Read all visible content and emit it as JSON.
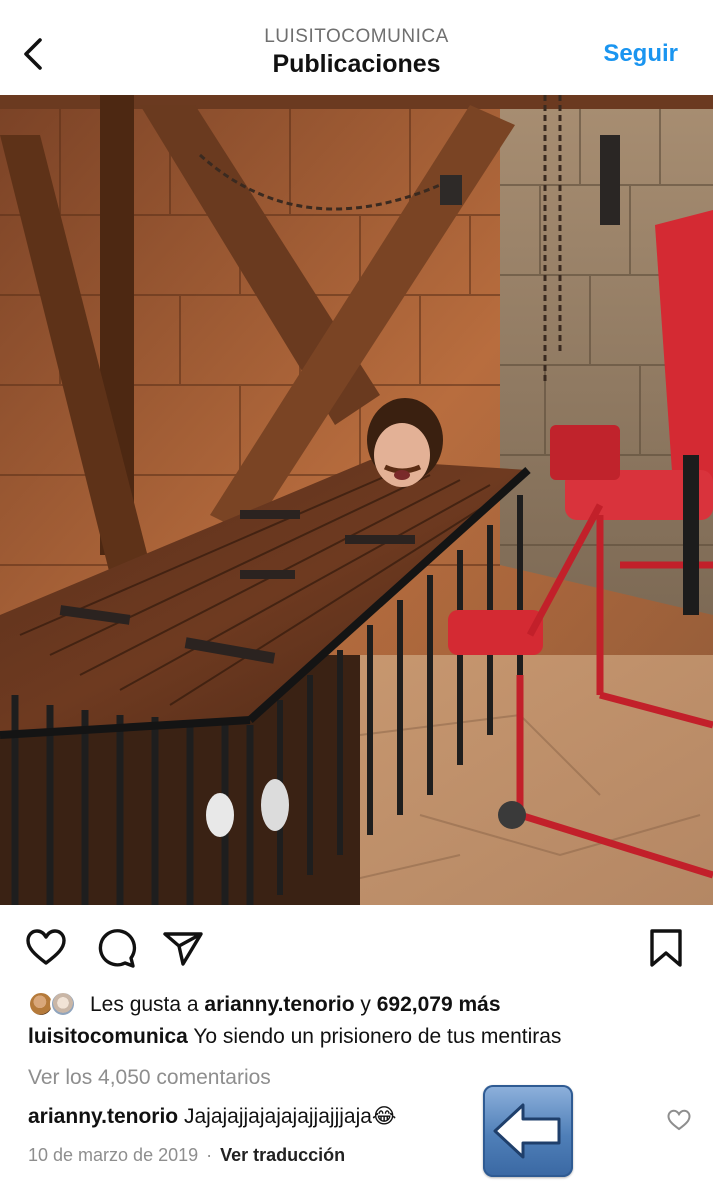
{
  "header": {
    "username": "LUISITOCOMUNICA",
    "title": "Publicaciones",
    "follow_label": "Seguir"
  },
  "post": {
    "likes_prefix": "Les gusta a ",
    "liked_by": "arianny.tenorio",
    "likes_join": " y ",
    "likes_count": "692,079 más",
    "caption_user": "luisitocomunica",
    "caption_text": " Yo siendo un prisionero de tus mentiras",
    "view_comments": "Ver los 4,050 comentarios",
    "comment_user": "arianny.tenorio",
    "comment_text": " Jajajajjajajajajjajjjaja😂",
    "date": "10 de marzo de 2019",
    "separator": "·",
    "translate_label": "Ver traducción"
  },
  "icons": {
    "back": "chevron-left-icon",
    "like": "heart-icon",
    "comment": "comment-icon",
    "share": "paper-plane-icon",
    "save": "bookmark-icon",
    "overlay": "arrow-left-icon"
  },
  "colors": {
    "accent": "#1a95f0",
    "muted": "#8e8e8e",
    "text": "#111111"
  }
}
